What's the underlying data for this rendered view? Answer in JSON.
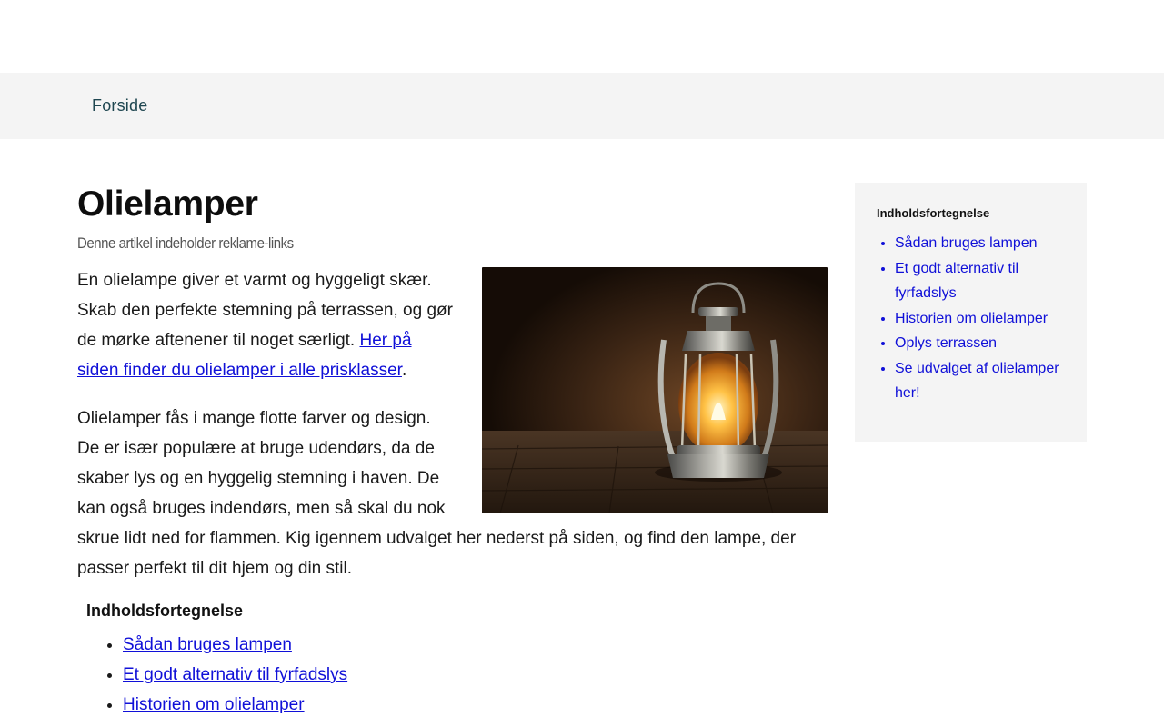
{
  "nav": {
    "home_label": "Forside"
  },
  "article": {
    "title": "Olielamper",
    "disclaimer": "Denne artikel indeholder reklame-links",
    "p1_text": "En olielampe giver et varmt og hyggeligt skær. Skab den perfekte stemning på terrassen, og gør de mørke aftenener til noget særligt. ",
    "p1_link": "Her på siden finder du olielamper i alle prisklasser",
    "p1_end": ".",
    "p2_text": "Olielamper fås i mange flotte farver og design. De er især populære at bruge udendørs, da de skaber lys og en hyggelig stemning i haven. De kan også bruges indendørs, men så skal du nok skrue lidt ned for flammen. Kig igennem udvalget her nederst på siden, og find den lampe, der passer perfekt til dit hjem og din stil.",
    "hero_image": "oil-lantern-photo"
  },
  "toc_inline": {
    "heading": "Indholdsfortegnelse",
    "items": [
      "Sådan bruges lampen",
      "Et godt alternativ til fyrfadslys",
      "Historien om olielamper"
    ]
  },
  "sidebar": {
    "heading": "Indholdsfortegnelse",
    "items": [
      "Sådan bruges lampen",
      "Et godt alternativ til fyrfadslys",
      "Historien om olielamper",
      "Oplys terrassen",
      "Se udvalget af olielamper her!"
    ]
  },
  "colors": {
    "link": "#1010d8",
    "nav_bg": "#f4f4f4",
    "nav_text": "#1e4650"
  }
}
